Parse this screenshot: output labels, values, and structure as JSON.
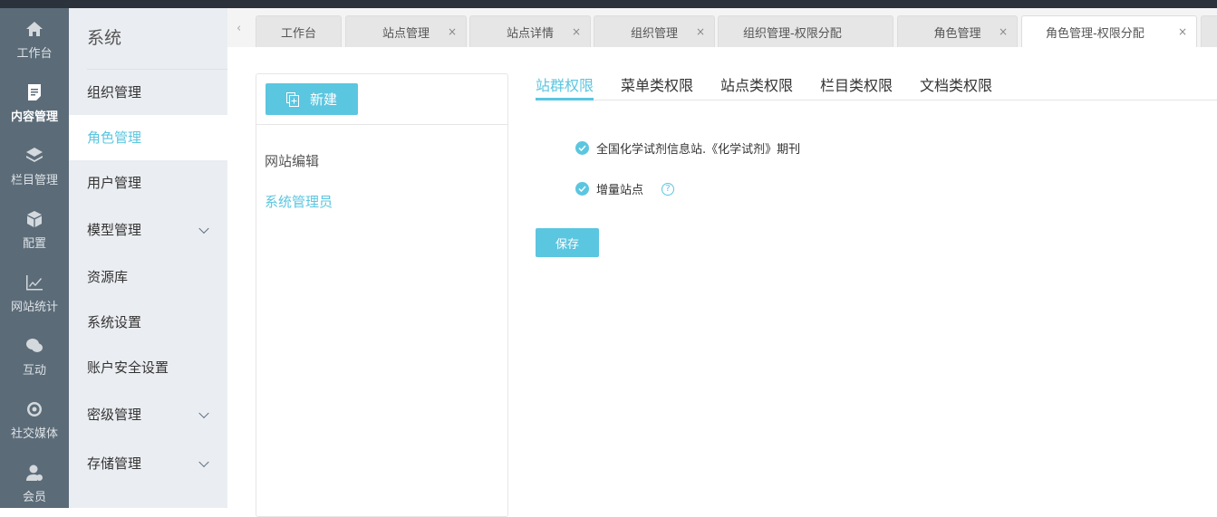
{
  "rail": [
    {
      "label": "工作台",
      "icon": "home-icon"
    },
    {
      "label": "内容管理",
      "icon": "document-icon",
      "active": true
    },
    {
      "label": "栏目管理",
      "icon": "layers-icon"
    },
    {
      "label": "配置",
      "icon": "cube-icon"
    },
    {
      "label": "网站统计",
      "icon": "chart-line-icon"
    },
    {
      "label": "互动",
      "icon": "chat-icon"
    },
    {
      "label": "社交媒体",
      "icon": "social-icon"
    },
    {
      "label": "会员",
      "icon": "user-icon"
    }
  ],
  "sidebar": {
    "title": "系统",
    "items": [
      {
        "label": "组织管理"
      },
      {
        "label": "角色管理",
        "active": true
      },
      {
        "label": "用户管理"
      },
      {
        "label": "模型管理",
        "expandable": true
      },
      {
        "label": "资源库"
      },
      {
        "label": "系统设置"
      },
      {
        "label": "账户安全设置"
      },
      {
        "label": "密级管理",
        "expandable": true
      },
      {
        "label": "存储管理",
        "expandable": true
      }
    ]
  },
  "tabs": [
    {
      "label": "工作台"
    },
    {
      "label": "站点管理"
    },
    {
      "label": "站点详情"
    },
    {
      "label": "组织管理"
    },
    {
      "label": "组织管理-权限分配"
    },
    {
      "label": "角色管理"
    },
    {
      "label": "角色管理-权限分配",
      "active": true
    }
  ],
  "close_glyph": "×",
  "roles": {
    "new_label": "新建",
    "items": [
      {
        "label": "网站编辑"
      },
      {
        "label": "系统管理员",
        "active": true
      }
    ]
  },
  "perm_tabs": [
    {
      "label": "站群权限",
      "active": true
    },
    {
      "label": "菜单类权限"
    },
    {
      "label": "站点类权限"
    },
    {
      "label": "栏目类权限"
    },
    {
      "label": "文档类权限"
    }
  ],
  "perms": [
    {
      "label": "全国化学试剂信息站.《化学试剂》期刊",
      "checked": true
    },
    {
      "label": "增量站点",
      "checked": true,
      "help": "?"
    }
  ],
  "save_label": "保存",
  "colors": {
    "accent": "#5bc6e0",
    "rail": "#5b6b78",
    "sidebar": "#eaedf1",
    "topbar": "#2b323b"
  }
}
